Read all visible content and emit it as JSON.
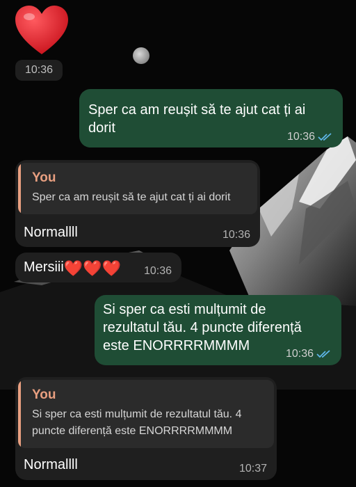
{
  "messages": {
    "m0": {
      "sticker_icon": "red-heart-icon",
      "time": "10:36"
    },
    "m1": {
      "text": "Sper ca am reușit să te ajut cat ți ai dorit",
      "time": "10:36",
      "status_icon": "double-check-read-icon"
    },
    "m2": {
      "reply_to": {
        "author": "You",
        "text": "Sper ca am reușit să te ajut cat ți ai dorit"
      },
      "text": "Normallll",
      "time": "10:36"
    },
    "m3": {
      "text": "Mersiii",
      "emoji": "❤️❤️❤️",
      "time": "10:36"
    },
    "m4": {
      "text": "Si sper ca esti mulțumit de rezultatul tău. 4 puncte diferență este ENORRRRMMMM",
      "time": "10:36",
      "status_icon": "double-check-read-icon"
    },
    "m5": {
      "reply_to": {
        "author": "You",
        "text": "Si sper ca esti mulțumit de rezultatul tău. 4 puncte diferență este ENORRRRMMMM"
      },
      "text": "Normallll",
      "time": "10:37"
    }
  },
  "colors": {
    "outgoing_bubble": "#1f4d35",
    "incoming_bubble": "#1f1f1f",
    "quote_accent": "#e89f80",
    "read_ticks": "#5fb6e8",
    "heart": "#e0222c"
  }
}
